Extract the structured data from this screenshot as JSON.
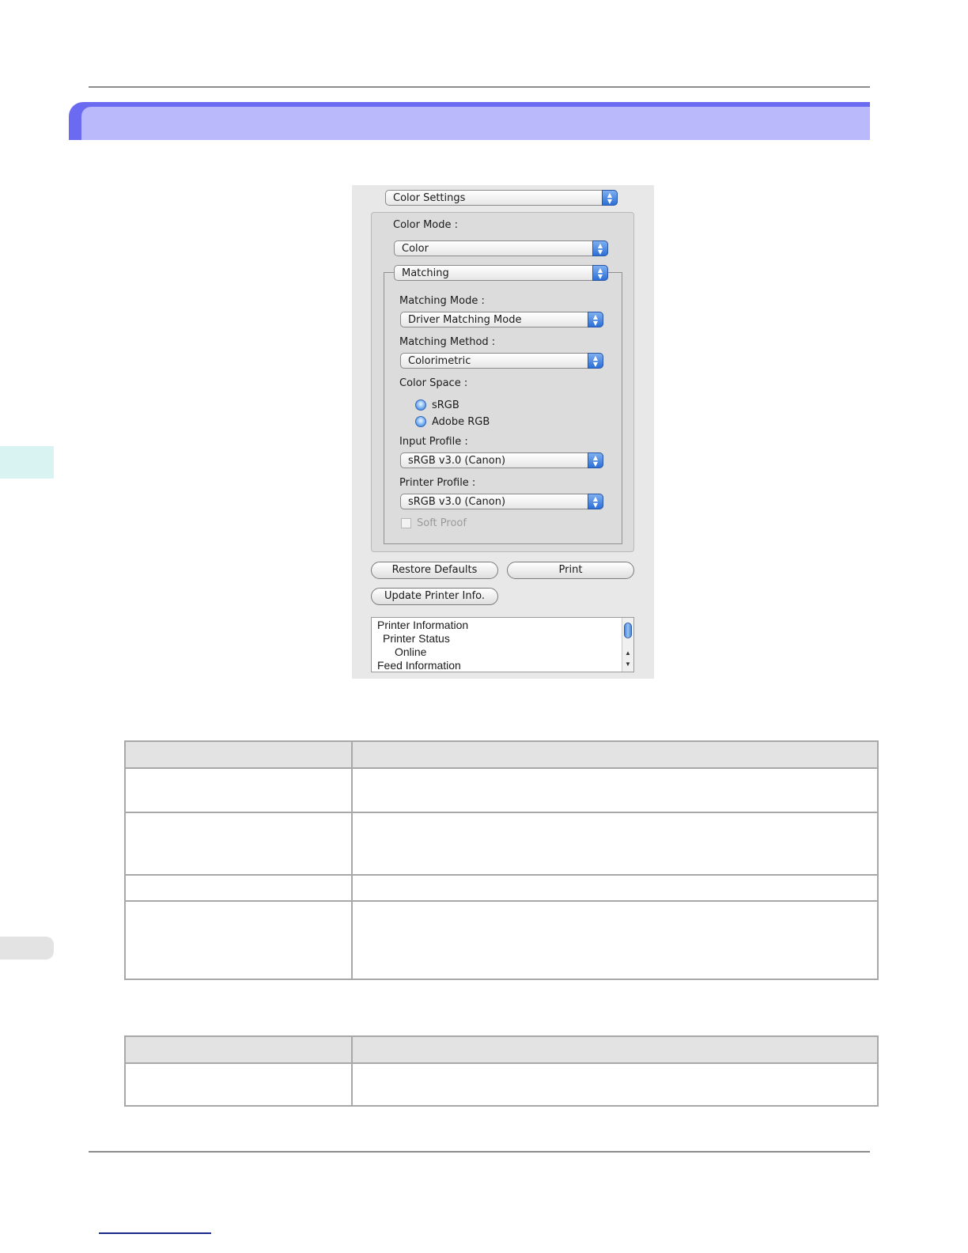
{
  "dialog": {
    "section_popup": "Color Settings",
    "color_mode_label": "Color Mode :",
    "color_mode_value": "Color",
    "group_popup": "Matching",
    "matching_mode_label": "Matching Mode :",
    "matching_mode_value": "Driver Matching Mode",
    "matching_method_label": "Matching Method :",
    "matching_method_value": "Colorimetric",
    "color_space_label": "Color Space :",
    "color_space_options": [
      "sRGB",
      "Adobe RGB"
    ],
    "input_profile_label": "Input Profile :",
    "input_profile_value": "sRGB v3.0 (Canon)",
    "printer_profile_label": "Printer Profile :",
    "printer_profile_value": "sRGB v3.0 (Canon)",
    "soft_proof_label": "Soft Proof",
    "restore_defaults_label": "Restore Defaults",
    "print_label": "Print",
    "update_printer_info_label": "Update Printer Info.",
    "printer_info_lines": [
      "Printer Information",
      "Printer Status",
      "Online",
      "Feed Information"
    ]
  },
  "colors": {
    "banner_outer": "#6b6bf2",
    "banner_inner": "#b9b9fb",
    "side_tab": "#d9f2f2",
    "table_header": "#e3e3e3"
  }
}
